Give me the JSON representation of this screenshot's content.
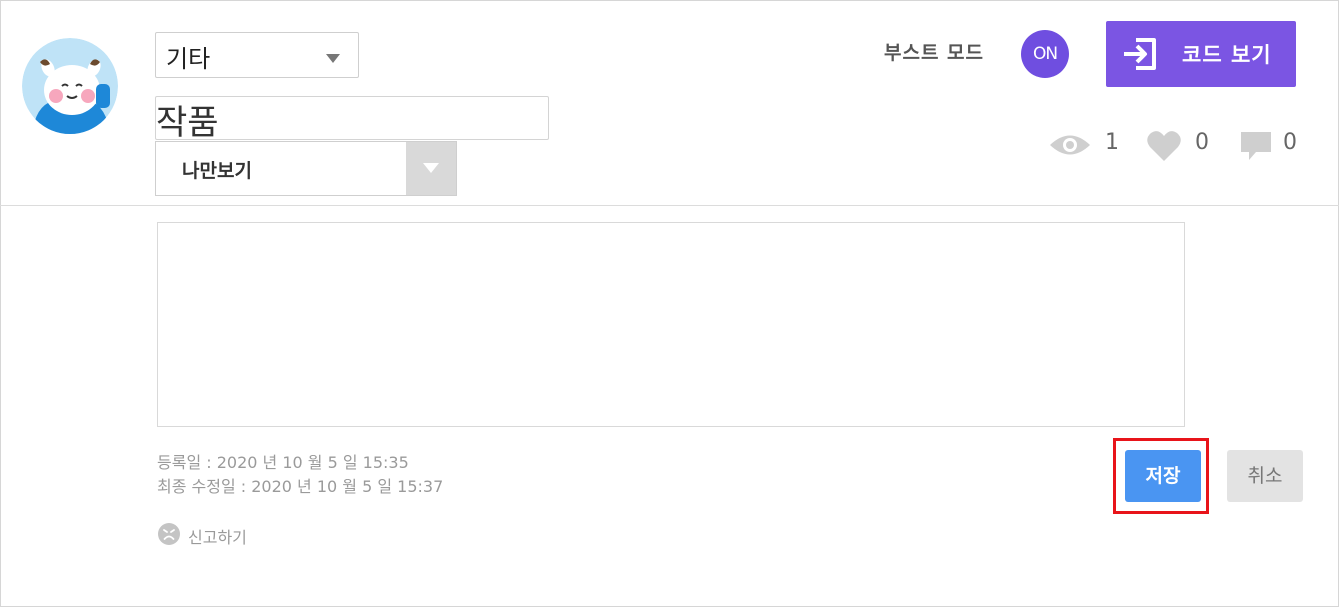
{
  "project": {
    "category": "기타",
    "title": "작품",
    "visibility": "나만보기",
    "description": ""
  },
  "boost_mode": {
    "label": "부스트 모드",
    "state": "ON"
  },
  "code_view": {
    "label": "코드 보기",
    "icon": "enter-code-icon"
  },
  "stats": {
    "views": "1",
    "likes": "0",
    "comments": "0"
  },
  "dates": {
    "registered": "등록일 : 2020 년 10 월 5 일 15:35",
    "modified": "최종 수정일 : 2020 년 10 월 5 일 15:37"
  },
  "report": {
    "label": "신고하기"
  },
  "actions": {
    "save_label": "저장",
    "cancel_label": "취소"
  },
  "colors": {
    "accent_purple": "#7b55e3",
    "toggle_purple": "#6f4ee0",
    "save_blue": "#4a95f2",
    "highlight_red": "#e8141a"
  }
}
